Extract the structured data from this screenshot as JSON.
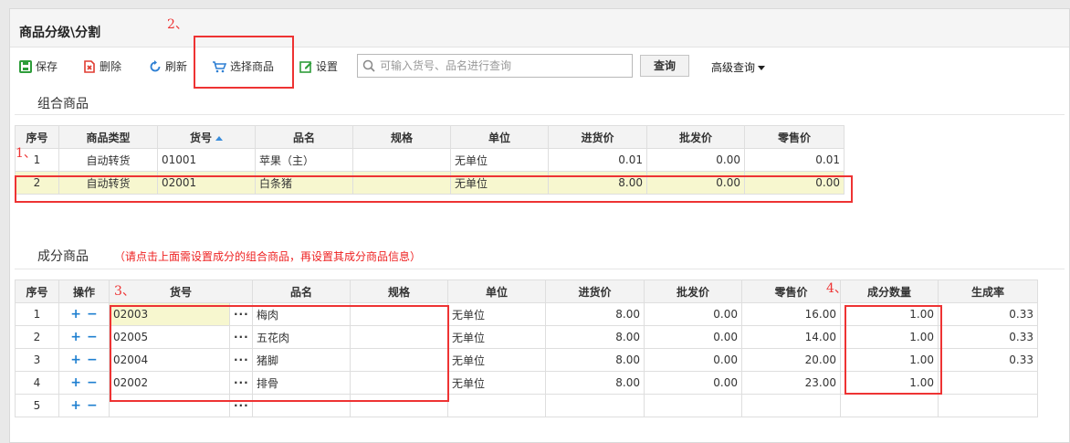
{
  "page": {
    "title": "商品分级\\分割"
  },
  "toolbar": {
    "save": "保存",
    "delete": "删除",
    "refresh": "刷新",
    "select_goods": "选择商品",
    "settings": "设置",
    "search_placeholder": "可输入货号、品名进行查询",
    "query": "查询",
    "advanced": "高级查询"
  },
  "combo": {
    "section_title": "组合商品",
    "headers": [
      "序号",
      "商品类型",
      "货号",
      "品名",
      "规格",
      "单位",
      "进货价",
      "批发价",
      "零售价"
    ],
    "rows": [
      {
        "no": "1",
        "type": "自动转货",
        "code": "01001",
        "name": "苹果（主）",
        "spec": "",
        "unit": "无单位",
        "purchase": "0.01",
        "wholesale": "0.00",
        "retail": "0.01"
      },
      {
        "no": "2",
        "type": "自动转货",
        "code": "02001",
        "name": "白条猪",
        "spec": "",
        "unit": "无单位",
        "purchase": "8.00",
        "wholesale": "0.00",
        "retail": "0.00"
      }
    ]
  },
  "components": {
    "section_title": "成分商品",
    "hint": "（请点击上面需设置成分的组合商品，再设置其成分商品信息）",
    "headers": [
      "序号",
      "操作",
      "货号",
      "",
      "品名",
      "规格",
      "单位",
      "进货价",
      "批发价",
      "零售价",
      "成分数量",
      "生成率"
    ],
    "op_plus": "+",
    "op_minus": "−",
    "dots": "···",
    "rows": [
      {
        "no": "1",
        "code": "02003",
        "name": "梅肉",
        "spec": "",
        "unit": "无单位",
        "purchase": "8.00",
        "wholesale": "0.00",
        "retail": "16.00",
        "qty": "1.00",
        "rate": "0.33"
      },
      {
        "no": "2",
        "code": "02005",
        "name": "五花肉",
        "spec": "",
        "unit": "无单位",
        "purchase": "8.00",
        "wholesale": "0.00",
        "retail": "14.00",
        "qty": "1.00",
        "rate": "0.33"
      },
      {
        "no": "3",
        "code": "02004",
        "name": "猪脚",
        "spec": "",
        "unit": "无单位",
        "purchase": "8.00",
        "wholesale": "0.00",
        "retail": "20.00",
        "qty": "1.00",
        "rate": "0.33"
      },
      {
        "no": "4",
        "code": "02002",
        "name": "排骨",
        "spec": "",
        "unit": "无单位",
        "purchase": "8.00",
        "wholesale": "0.00",
        "retail": "23.00",
        "qty": "1.00",
        "rate": ""
      },
      {
        "no": "5",
        "code": "",
        "name": "",
        "spec": "",
        "unit": "",
        "purchase": "",
        "wholesale": "",
        "retail": "",
        "qty": "",
        "rate": ""
      }
    ]
  },
  "annotations": {
    "a1": "1、",
    "a2": "2、",
    "a3": "3、",
    "a4": "4、"
  },
  "colors": {
    "accent_blue": "#1e7fd0",
    "annotation_red": "#e33",
    "selected_row": "#f7f7cf"
  }
}
